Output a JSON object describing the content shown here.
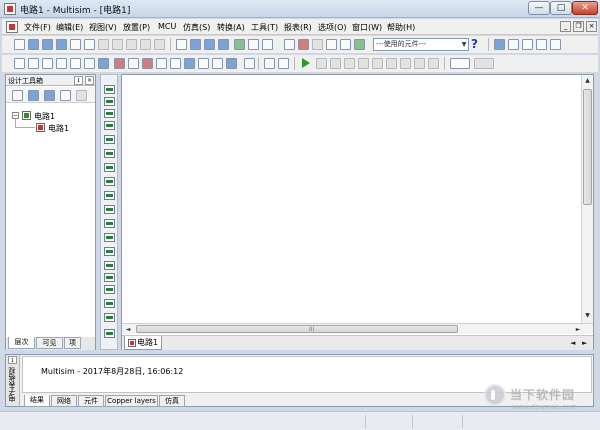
{
  "window": {
    "title": "电路1 - Multisim - [电路1]",
    "min_glyph": "—",
    "max_glyph": "□",
    "close_glyph": "✕"
  },
  "menu": {
    "items": [
      "文件(F)",
      "编辑(E)",
      "视图(V)",
      "放置(P)",
      "MCU",
      "仿真(S)",
      "转换(A)",
      "工具(T)",
      "报表(R)",
      "选项(O)",
      "窗口(W)",
      "帮助(H)"
    ],
    "mdi_min": "_",
    "mdi_restore": "❐",
    "mdi_close": "×"
  },
  "toolbar": {
    "component_select_value": "---使用的元件---",
    "dropdown_arrow": "▼",
    "help_glyph": "?"
  },
  "toolbox": {
    "title": "设计工具箱",
    "pin_glyph": "ɪ",
    "close_glyph": "×",
    "tree": {
      "expander": "−",
      "root_label": "电路1",
      "child_label": "电路1"
    },
    "tabs": [
      "层次",
      "可见",
      "项"
    ]
  },
  "workspace": {
    "doc_tab_label": "电路1",
    "scroll_up": "▲",
    "scroll_down": "▼",
    "scroll_left": "◄",
    "scroll_right": "►",
    "grip": "III",
    "nav_left": "◄",
    "nav_right": "►"
  },
  "output": {
    "side_label": "电子表格视",
    "pin_glyph": "ɪ",
    "message": "Multisim  -  2017年8月28日, 16:06:12",
    "tabs": [
      "结果",
      "网络",
      "元件",
      "Copper layers",
      "仿真"
    ]
  },
  "watermark": {
    "name": "当下软件园",
    "url": "www.downxia.com"
  },
  "colors": {
    "accent": "#1c3fa8",
    "close_red": "#c8402a",
    "run_green": "#2c9a2c"
  }
}
